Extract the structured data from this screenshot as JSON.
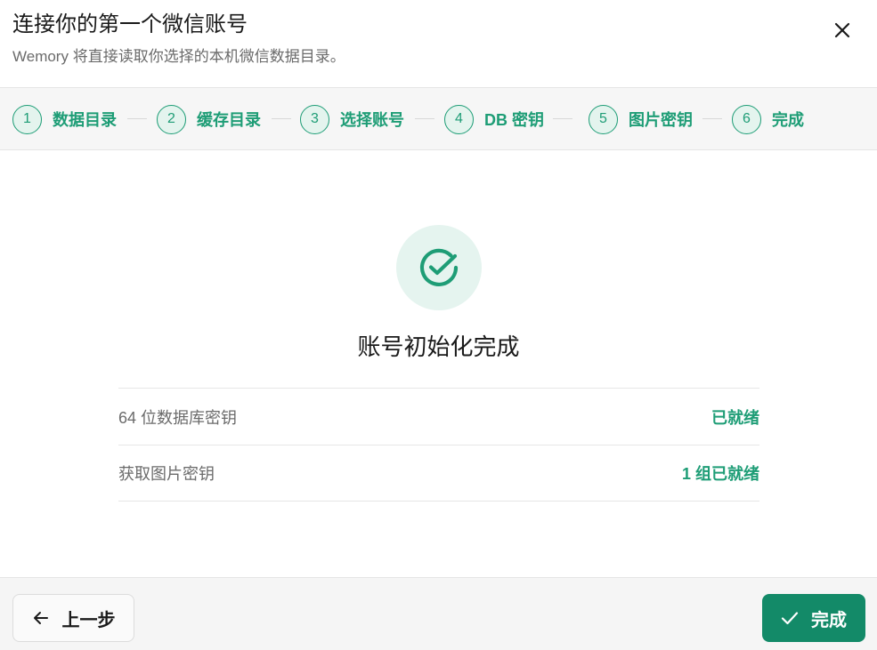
{
  "header": {
    "title": "连接你的第一个微信账号",
    "subtitle": "Wemory 将直接读取你选择的本机微信数据目录。",
    "close_icon": "close-icon"
  },
  "steps": [
    {
      "num": "1",
      "label": "数据目录"
    },
    {
      "num": "2",
      "label": "缓存目录"
    },
    {
      "num": "3",
      "label": "选择账号"
    },
    {
      "num": "4",
      "label": "DB 密钥"
    },
    {
      "num": "5",
      "label": "图片密钥"
    },
    {
      "num": "6",
      "label": "完成"
    }
  ],
  "main": {
    "success_icon": "check-circle-icon",
    "title": "账号初始化完成",
    "status_rows": [
      {
        "label": "64 位数据库密钥",
        "value": "已就绪"
      },
      {
        "label": "获取图片密钥",
        "value": "1 组已就绪"
      }
    ]
  },
  "footer": {
    "back_label": "上一步",
    "back_icon": "arrow-left-icon",
    "finish_label": "完成",
    "finish_icon": "check-icon"
  },
  "colors": {
    "accent": "#1e9d76",
    "button_primary": "#138a68",
    "step_bg": "#e4f4ee"
  }
}
